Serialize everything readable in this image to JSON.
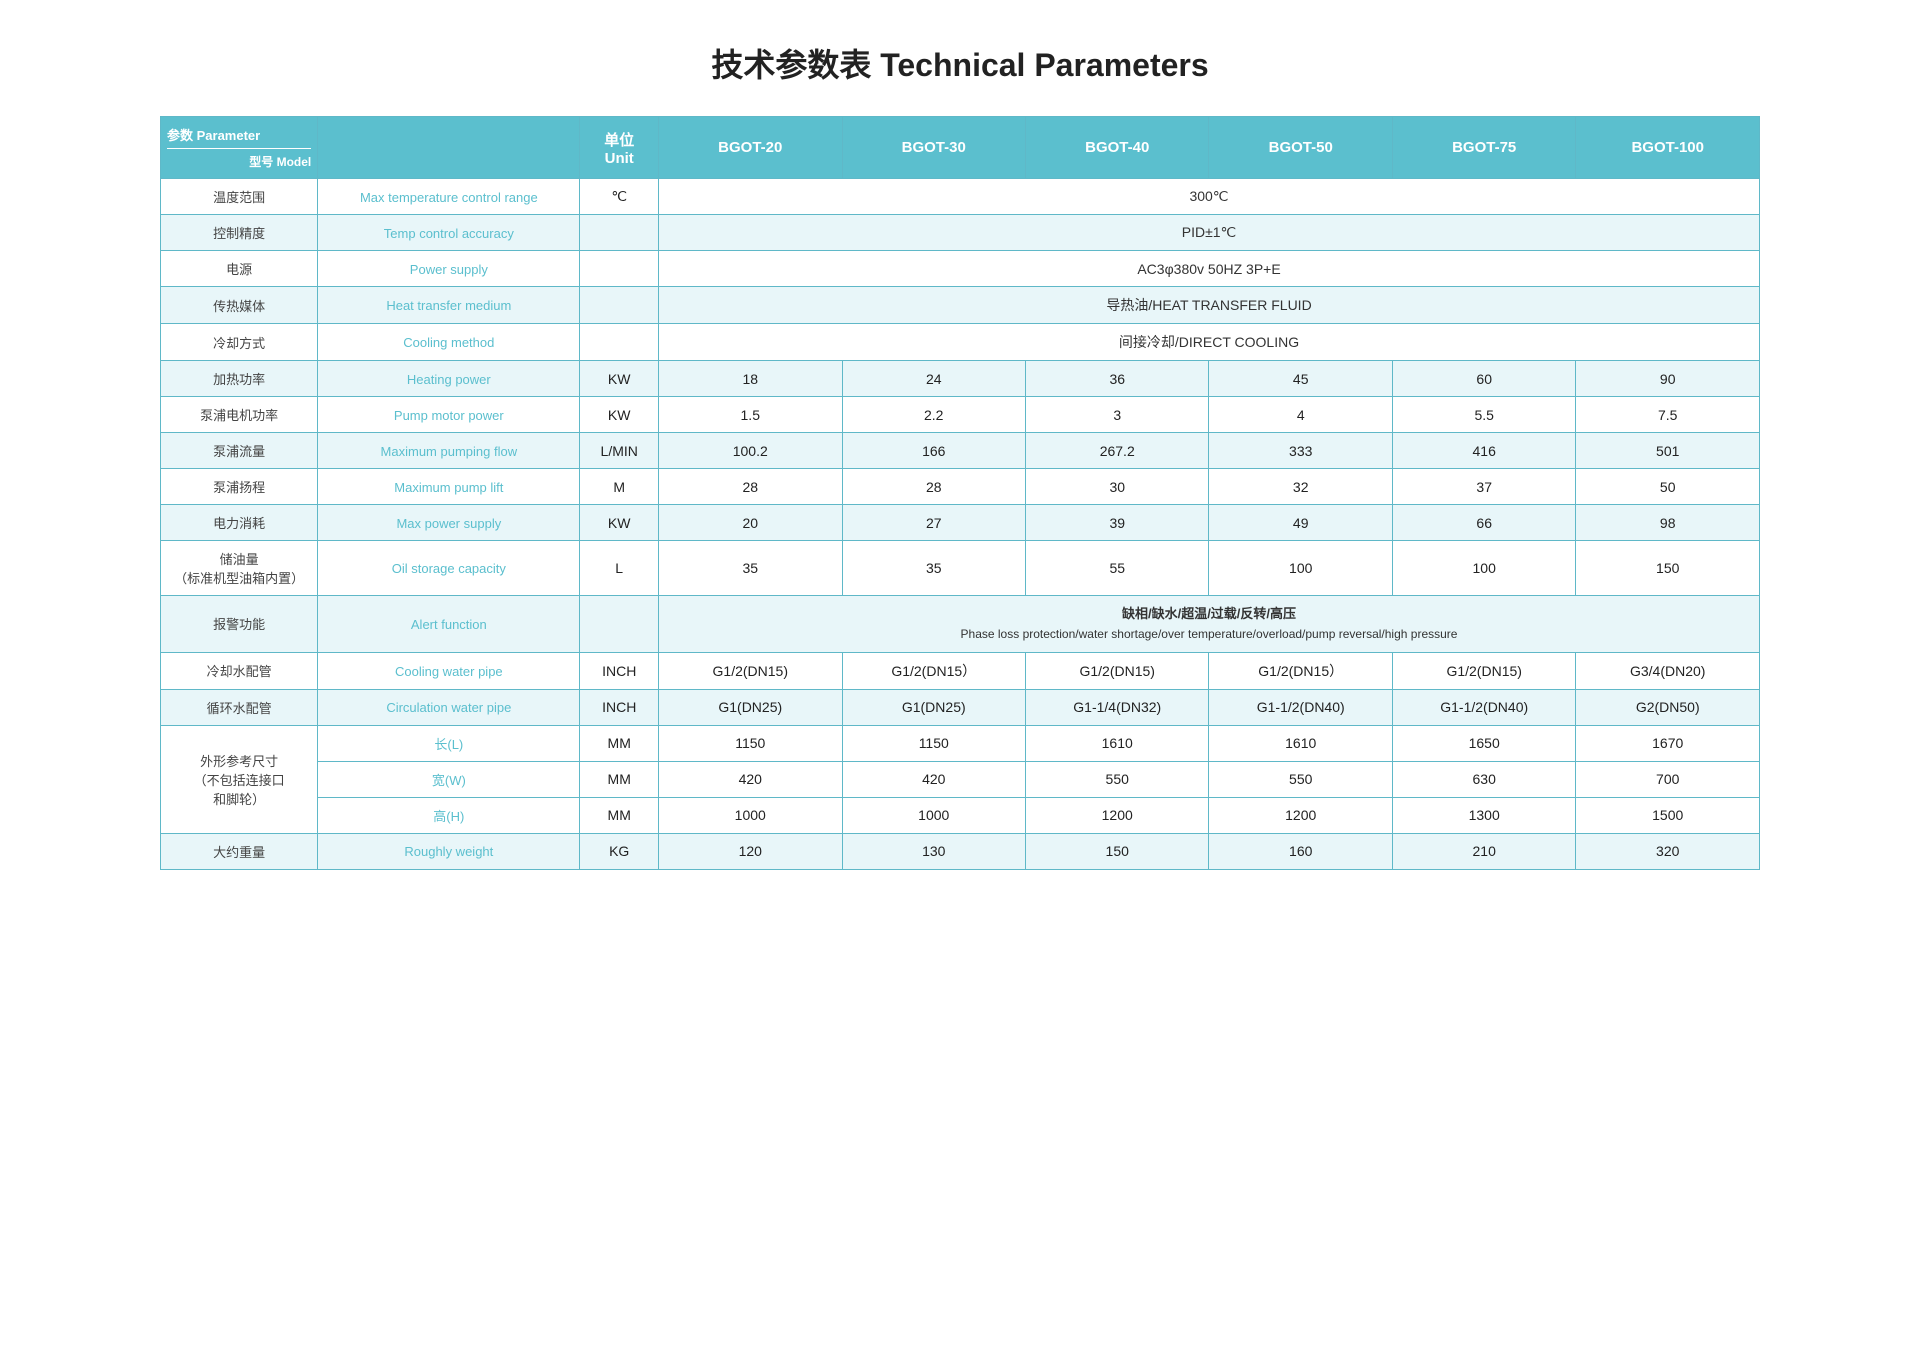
{
  "title": "技术参数表 Technical Parameters",
  "table": {
    "header": {
      "param_zh": "参数 Parameter",
      "model_zh": "型号 Model",
      "unit_zh": "单位",
      "unit_en": "Unit",
      "models": [
        "BGOT-20",
        "BGOT-30",
        "BGOT-40",
        "BGOT-50",
        "BGOT-75",
        "BGOT-100"
      ]
    },
    "rows": [
      {
        "param_zh": "温度范围",
        "param_en": "Max temperature control range",
        "unit": "℃",
        "merged": true,
        "merged_value": "300℃",
        "values": []
      },
      {
        "param_zh": "控制精度",
        "param_en": "Temp control accuracy",
        "unit": "",
        "merged": true,
        "merged_value": "PID±1℃",
        "values": []
      },
      {
        "param_zh": "电源",
        "param_en": "Power supply",
        "unit": "",
        "merged": true,
        "merged_value": "AC3φ380v 50HZ 3P+E",
        "values": []
      },
      {
        "param_zh": "传热媒体",
        "param_en": "Heat transfer medium",
        "unit": "",
        "merged": true,
        "merged_value": "导热油/HEAT TRANSFER FLUID",
        "values": []
      },
      {
        "param_zh": "冷却方式",
        "param_en": "Cooling method",
        "unit": "",
        "merged": true,
        "merged_value": "间接冷却/DIRECT COOLING",
        "values": []
      },
      {
        "param_zh": "加热功率",
        "param_en": "Heating power",
        "unit": "KW",
        "merged": false,
        "values": [
          "18",
          "24",
          "36",
          "45",
          "60",
          "90"
        ]
      },
      {
        "param_zh": "泵浦电机功率",
        "param_en": "Pump motor power",
        "unit": "KW",
        "merged": false,
        "values": [
          "1.5",
          "2.2",
          "3",
          "4",
          "5.5",
          "7.5"
        ]
      },
      {
        "param_zh": "泵浦流量",
        "param_en": "Maximum pumping flow",
        "unit": "L/MIN",
        "merged": false,
        "values": [
          "100.2",
          "166",
          "267.2",
          "333",
          "416",
          "501"
        ]
      },
      {
        "param_zh": "泵浦扬程",
        "param_en": "Maximum pump lift",
        "unit": "M",
        "merged": false,
        "values": [
          "28",
          "28",
          "30",
          "32",
          "37",
          "50"
        ]
      },
      {
        "param_zh": "电力消耗",
        "param_en": "Max power supply",
        "unit": "KW",
        "merged": false,
        "values": [
          "20",
          "27",
          "39",
          "49",
          "66",
          "98"
        ]
      },
      {
        "param_zh": "储油量\n（标准机型油箱内置）",
        "param_en": "Oil storage capacity",
        "unit": "L",
        "merged": false,
        "values": [
          "35",
          "35",
          "55",
          "100",
          "100",
          "150"
        ]
      },
      {
        "param_zh": "报警功能",
        "param_en": "Alert function",
        "unit": "",
        "merged": true,
        "merged_value": "缺相/缺水/超温/过载/反转/高压\nPhase loss protection/water shortage/over temperature/overload/pump reversal/high pressure",
        "values": []
      },
      {
        "param_zh": "冷却水配管",
        "param_en": "Cooling water pipe",
        "unit": "INCH",
        "merged": false,
        "values": [
          "G1/2(DN15)",
          "G1/2(DN15）",
          "G1/2(DN15)",
          "G1/2(DN15）",
          "G1/2(DN15)",
          "G3/4(DN20)"
        ]
      },
      {
        "param_zh": "循环水配管",
        "param_en": "Circulation water pipe",
        "unit": "INCH",
        "merged": false,
        "values": [
          "G1(DN25)",
          "G1(DN25)",
          "G1-1/4(DN32)",
          "G1-1/2(DN40)",
          "G1-1/2(DN40)",
          "G2(DN50)"
        ]
      },
      {
        "param_zh": "外形参考尺寸\n（不包括连接口\n和脚轮）",
        "param_en_sub": [
          {
            "label_zh": "长(L)",
            "unit": "MM",
            "values": [
              "1150",
              "1150",
              "1610",
              "1610",
              "1650",
              "1670"
            ]
          },
          {
            "label_zh": "宽(W)",
            "unit": "MM",
            "values": [
              "420",
              "420",
              "550",
              "550",
              "630",
              "700"
            ]
          },
          {
            "label_zh": "高(H)",
            "unit": "MM",
            "values": [
              "1000",
              "1000",
              "1200",
              "1200",
              "1300",
              "1500"
            ]
          }
        ],
        "is_dimension": true
      },
      {
        "param_zh": "大约重量",
        "param_en": "Roughly weight",
        "unit": "KG",
        "merged": false,
        "values": [
          "120",
          "130",
          "150",
          "160",
          "210",
          "320"
        ]
      }
    ]
  }
}
